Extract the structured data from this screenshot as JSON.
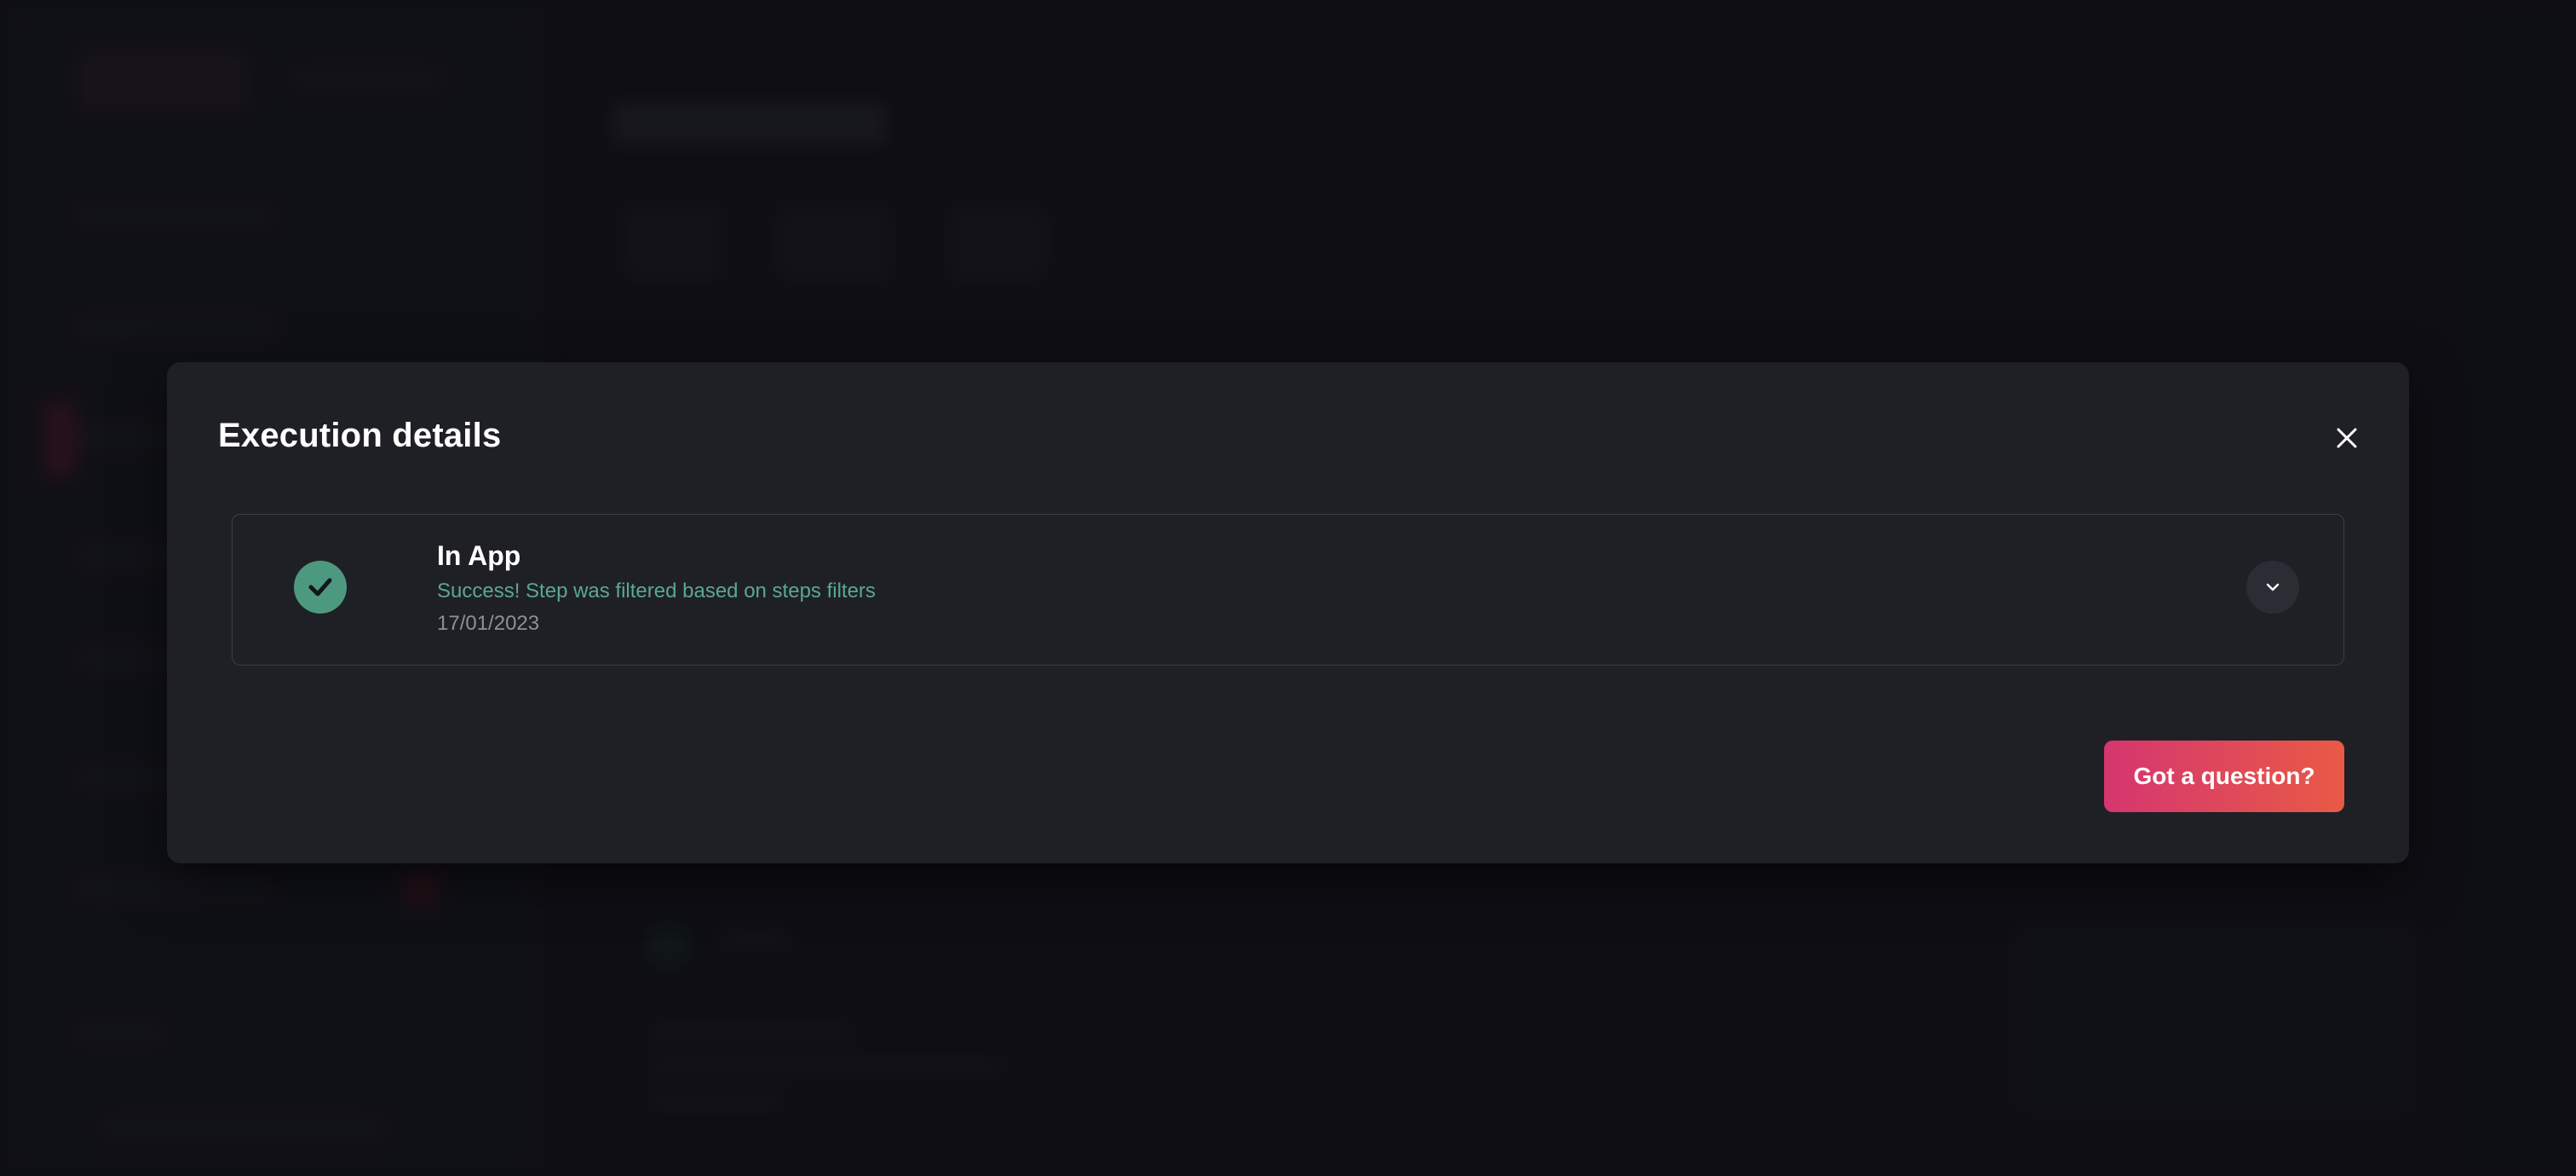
{
  "modal": {
    "title": "Execution details",
    "close_icon": "close-icon",
    "step": {
      "name": "In App",
      "status_text": "Success! Step was filtered based on steps filters",
      "date": "17/01/2023",
      "status_icon": "check-icon",
      "expand_icon": "chevron-down-icon"
    },
    "question_button_label": "Got a question?"
  },
  "colors": {
    "success": "#4d9980",
    "success_text": "#5aa88f",
    "button_gradient_start": "#d5366f",
    "button_gradient_end": "#e85a45",
    "modal_background": "#1f2025"
  }
}
